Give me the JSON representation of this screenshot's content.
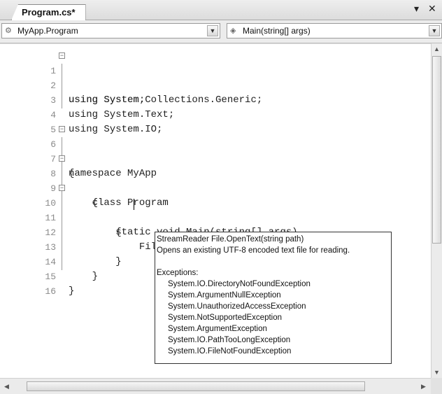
{
  "tab": {
    "title": "Program.cs*"
  },
  "window_controls": {
    "pin": "▾",
    "close": "✕"
  },
  "nav": {
    "type_combo": "MyApp.Program",
    "member_combo": "Main(string[] args)"
  },
  "lines": [
    {
      "num": "1",
      "text": "using System;"
    },
    {
      "num": "2",
      "text": "using System.Collections.Generic;"
    },
    {
      "num": "3",
      "text": "using System.Text;"
    },
    {
      "num": "4",
      "text": "using System.IO;"
    },
    {
      "num": "5",
      "text": ""
    },
    {
      "num": "6",
      "text": "namespace MyApp"
    },
    {
      "num": "7",
      "text": "{"
    },
    {
      "num": "8",
      "text": "    class Program"
    },
    {
      "num": "9",
      "text": "    {"
    },
    {
      "num": "10",
      "text": "        static void Main(string[] args)"
    },
    {
      "num": "11",
      "text": "        {"
    },
    {
      "num": "12",
      "text": "            File.OpenText(\"SomeFile.txt\");"
    },
    {
      "num": "13",
      "text": "        }"
    },
    {
      "num": "14",
      "text": "    }"
    },
    {
      "num": "15",
      "text": "}"
    },
    {
      "num": "16",
      "text": ""
    }
  ],
  "tooltip": {
    "signature": "StreamReader File.OpenText(string path)",
    "summary": "Opens an existing UTF-8 encoded text file for reading.",
    "exceptions_header": "Exceptions:",
    "exceptions": [
      "System.IO.DirectoryNotFoundException",
      "System.ArgumentNullException",
      "System.UnauthorizedAccessException",
      "System.NotSupportedException",
      "System.ArgumentException",
      "System.IO.PathTooLongException",
      "System.IO.FileNotFoundException"
    ]
  }
}
